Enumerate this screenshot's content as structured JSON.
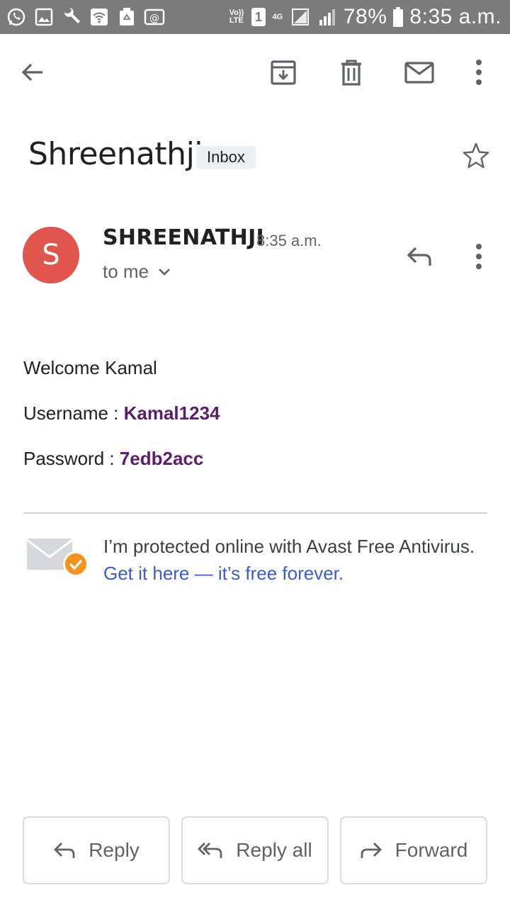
{
  "status_bar": {
    "volte": "Vo)) LTE",
    "sim": "1",
    "network": "4G",
    "battery": "78%",
    "time": "8:35 a.m."
  },
  "toolbar": {
    "back": "back-arrow-icon",
    "archive": "archive-icon",
    "delete": "trash-icon",
    "mark_unread": "mail-icon",
    "more": "more-vert-icon"
  },
  "email": {
    "subject": "Shreenathji",
    "label": "Inbox",
    "sender_initial": "S",
    "sender_name": "SHREENATHJI",
    "time": "8:35 a.m.",
    "recipient": "to me",
    "avatar_color": "#e0564f",
    "body": {
      "greeting": "Welcome Kamal",
      "username_label": "Username : ",
      "username_value": "Kamal1234",
      "password_label": "Password : ",
      "password_value": "7edb2acc"
    },
    "promo": {
      "text": "I’m protected online with Avast Free Antivirus. ",
      "link": "Get it here — it’s free forever."
    }
  },
  "actions": {
    "reply": "Reply",
    "reply_all": "Reply all",
    "forward": "Forward"
  },
  "colors": {
    "status_bar": "#7b7b7b",
    "link": "#3b5bcc",
    "credential": "#5a1f66",
    "promo_badge": "#f5921e"
  }
}
